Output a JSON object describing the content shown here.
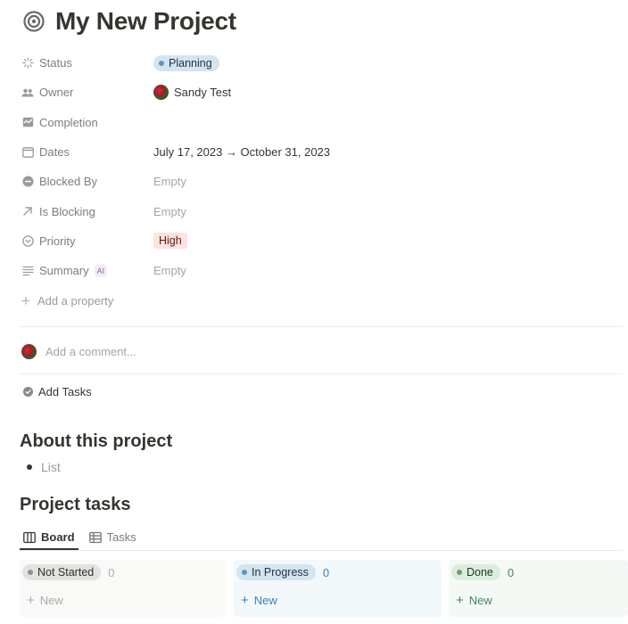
{
  "page": {
    "title": "My New Project",
    "icon": "target-icon"
  },
  "properties": [
    {
      "label": "Status",
      "icon": "status-loader-icon",
      "value": "Planning",
      "kind": "status-pill",
      "color": "#d3e5ef"
    },
    {
      "label": "Owner",
      "icon": "people-icon",
      "value": "Sandy Test",
      "kind": "person"
    },
    {
      "label": "Completion",
      "icon": "rollup-icon",
      "value": "",
      "kind": "empty-blank"
    },
    {
      "label": "Dates",
      "icon": "calendar-icon",
      "value": "July 17, 2023 → October 31, 2023",
      "kind": "text"
    },
    {
      "label": "Blocked By",
      "icon": "relation-icon",
      "value": "Empty",
      "kind": "empty"
    },
    {
      "label": "Is Blocking",
      "icon": "arrow-up-right-icon",
      "value": "Empty",
      "kind": "empty"
    },
    {
      "label": "Priority",
      "icon": "select-icon",
      "value": "High",
      "kind": "tag",
      "color": "#ffe2dd"
    },
    {
      "label": "Summary",
      "icon": "text-lines-icon",
      "badge": "AI",
      "value": "Empty",
      "kind": "empty"
    }
  ],
  "add_property_label": "Add a property",
  "comment": {
    "placeholder": "Add a comment..."
  },
  "add_tasks_label": "Add Tasks",
  "about": {
    "heading": "About this project",
    "bullets": [
      "List"
    ]
  },
  "tasks": {
    "heading": "Project tasks",
    "tabs": [
      {
        "label": "Board",
        "icon": "board-icon",
        "active": true
      },
      {
        "label": "Tasks",
        "icon": "table-icon",
        "active": false
      }
    ],
    "columns": [
      {
        "label": "Not Started",
        "count": "0",
        "new_label": "New",
        "color": "#e3e2e0"
      },
      {
        "label": "In Progress",
        "count": "0",
        "new_label": "New",
        "color": "#d3e5ef"
      },
      {
        "label": "Done",
        "count": "0",
        "new_label": "New",
        "color": "#dbeddb"
      }
    ]
  }
}
